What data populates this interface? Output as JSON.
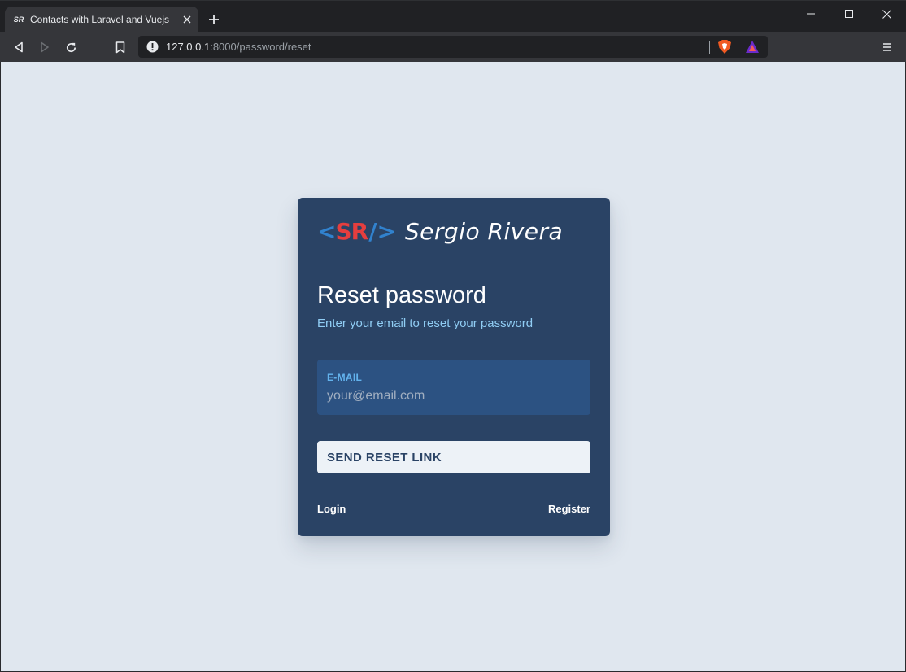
{
  "browser": {
    "tab_favicon_text": "SR",
    "tab_title": "Contacts with Laravel and Vuejs",
    "url_host": "127.0.0.1",
    "url_rest": ":8000/password/reset"
  },
  "logo": {
    "left_bracket": "<",
    "letters": "SR",
    "slash": "/",
    "right_bracket": ">",
    "name": "Sergio Rivera"
  },
  "form": {
    "heading": "Reset password",
    "subtitle": "Enter your email to reset your password",
    "email_label": "E-MAIL",
    "email_placeholder": "your@email.com",
    "email_value": "",
    "submit_label": "SEND RESET LINK"
  },
  "links": {
    "login": "Login",
    "register": "Register"
  },
  "colors": {
    "page_bg": "#e0e7ef",
    "card_bg": "#2a4365",
    "field_bg": "#2c5282",
    "accent_blue": "#3182ce",
    "accent_red": "#e53e3e",
    "subtitle": "#90cdf4"
  }
}
